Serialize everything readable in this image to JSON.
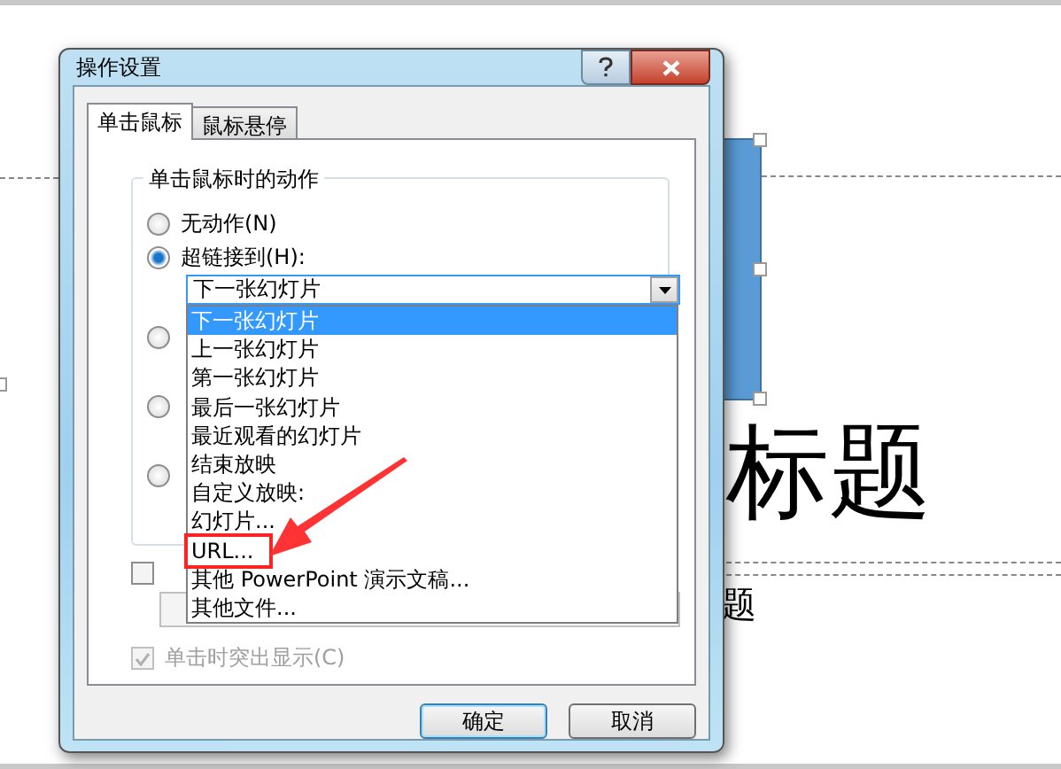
{
  "slide": {
    "title": "标题",
    "subtitle": "题"
  },
  "dialog": {
    "title": "操作设置",
    "tabs": [
      {
        "label": "单击鼠标",
        "selected": true
      },
      {
        "label": "鼠标悬停",
        "selected": false
      }
    ],
    "group": {
      "title": "单击鼠标时的动作",
      "radios": [
        {
          "label": "无动作(N)",
          "selected": false
        },
        {
          "label": "超链接到(H):",
          "selected": true
        },
        {
          "selected": false
        },
        {
          "selected": false
        },
        {
          "selected": false
        }
      ],
      "combo": {
        "value": "下一张幻灯片",
        "expanded": true
      }
    },
    "dropdown_items": [
      {
        "label": "下一张幻灯片",
        "selected": true,
        "annotated": false
      },
      {
        "label": "上一张幻灯片",
        "selected": false,
        "annotated": false
      },
      {
        "label": "第一张幻灯片",
        "selected": false,
        "annotated": false
      },
      {
        "label": "最后一张幻灯片",
        "selected": false,
        "annotated": false
      },
      {
        "label": "最近观看的幻灯片",
        "selected": false,
        "annotated": false
      },
      {
        "label": "结束放映",
        "selected": false,
        "annotated": false
      },
      {
        "label": "自定义放映:",
        "selected": false,
        "annotated": false
      },
      {
        "label": "幻灯片...",
        "selected": false,
        "annotated": false
      },
      {
        "label": "URL...",
        "selected": false,
        "annotated": true
      },
      {
        "label": "其他 PowerPoint 演示文稿...",
        "selected": false,
        "annotated": false
      },
      {
        "label": "其他文件...",
        "selected": false,
        "annotated": false
      }
    ],
    "play_sound": {
      "checked": false
    },
    "highlight_click": {
      "label": "单击时突出显示(C)",
      "checked": true,
      "disabled": true
    },
    "buttons": [
      {
        "label": "确定",
        "default": true
      },
      {
        "label": "取消",
        "default": false
      }
    ]
  }
}
